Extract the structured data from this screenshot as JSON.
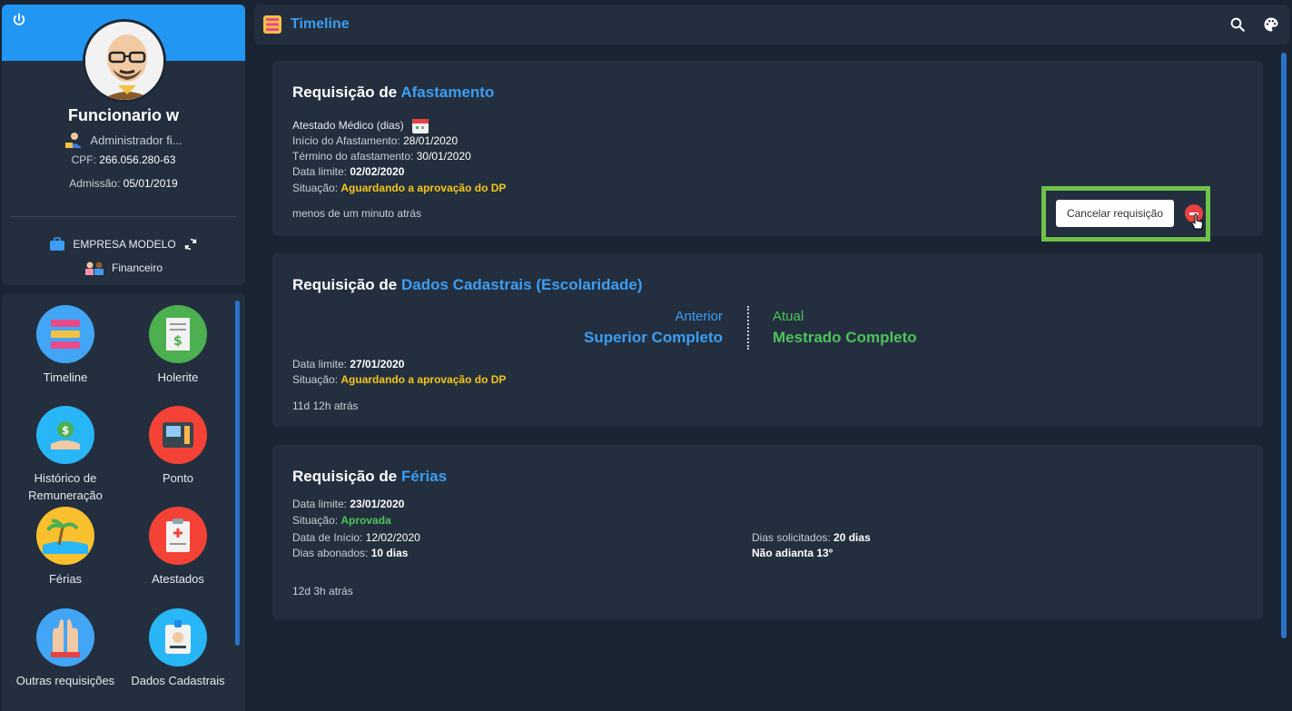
{
  "profile": {
    "name": "Funcionario w",
    "role": "Administrador fi...",
    "cpf_label": "CPF:",
    "cpf": "266.056.280-63",
    "admission_label": "Admissão:",
    "admission": "05/01/2019",
    "company": "EMPRESA MODELO",
    "department": "Financeiro"
  },
  "menu": {
    "items": [
      {
        "label": "Timeline",
        "icon": "timeline-icon",
        "color": "#42a5f5"
      },
      {
        "label": "Holerite",
        "icon": "payslip-icon",
        "color": "#4caf50"
      },
      {
        "label": "Histórico de Remuneração",
        "icon": "money-hand-icon",
        "color": "#29b6f6"
      },
      {
        "label": "Ponto",
        "icon": "time-clock-icon",
        "color": "#f44336"
      },
      {
        "label": "Férias",
        "icon": "beach-icon",
        "color": "#fbc02d"
      },
      {
        "label": "Atestados",
        "icon": "medical-certificate-icon",
        "color": "#f44336"
      },
      {
        "label": "Outras requisições",
        "icon": "raised-hands-icon",
        "color": "#42a5f5"
      },
      {
        "label": "Dados Cadastrais",
        "icon": "id-badge-icon",
        "color": "#29b6f6"
      }
    ]
  },
  "topbar": {
    "title": "Timeline"
  },
  "cards": {
    "afastamento": {
      "title_prefix": "Requisição de",
      "title_accent": "Afastamento",
      "type": "Atestado Médico (dias)",
      "start_label": "Início do Afastamento:",
      "start": "28/01/2020",
      "end_label": "Término do afastamento:",
      "end": "30/01/2020",
      "deadline_label": "Data limite:",
      "deadline": "02/02/2020",
      "status_label": "Situação:",
      "status": "Aguardando a aprovação do DP",
      "ago": "menos de um minuto atrás",
      "cancel_label": "Cancelar requisição"
    },
    "cadastrais": {
      "title_prefix": "Requisição de",
      "title_accent": "Dados Cadastrais (Escolaridade)",
      "previous_label": "Anterior",
      "previous_value": "Superior Completo",
      "current_label": "Atual",
      "current_value": "Mestrado Completo",
      "deadline_label": "Data limite:",
      "deadline": "27/01/2020",
      "status_label": "Situação:",
      "status": "Aguardando a aprovação do DP",
      "ago": "11d 12h atrás"
    },
    "ferias": {
      "title_prefix": "Requisição de",
      "title_accent": "Férias",
      "deadline_label": "Data limite:",
      "deadline": "23/01/2020",
      "status_label": "Situação:",
      "status": "Aprovada",
      "start_label": "Data de Início:",
      "start": "12/02/2020",
      "requested_label": "Dias solicitados:",
      "requested": "20 dias",
      "paid_label": "Dias abonados:",
      "paid": "10 dias",
      "advance": "Não adianta 13º",
      "ago": "12d 3h atrás"
    }
  }
}
